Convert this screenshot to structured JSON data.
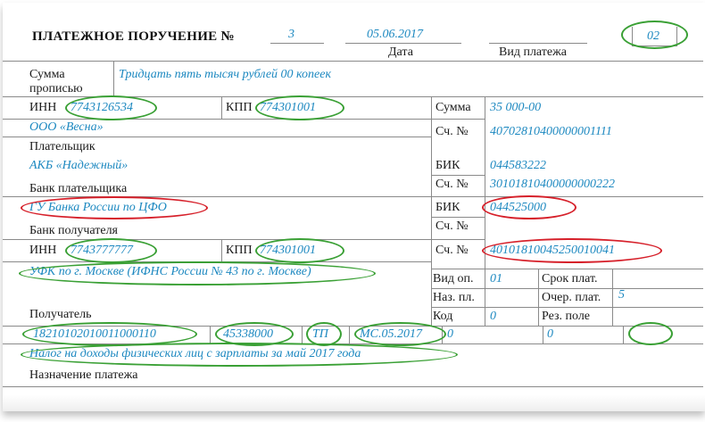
{
  "header": {
    "title": "ПЛАТЕЖНОЕ ПОРУЧЕНИЕ №",
    "number": "3",
    "date": "05.06.2017",
    "date_label": "Дата",
    "payment_type_label": "Вид платежа",
    "status_code": "02"
  },
  "amount_words": {
    "label_line1": "Сумма",
    "label_line2": "прописью",
    "value": "Тридцать пять тысяч рублей 00 копеек"
  },
  "payer": {
    "inn_label": "ИНН",
    "inn": "7743126534",
    "kpp_label": "КПП",
    "kpp": "774301001",
    "name": "ООО «Весна»",
    "label": "Плательщик",
    "amount_label": "Сумма",
    "amount": "35 000-00",
    "account_label": "Сч. №",
    "account": "40702810400000001111"
  },
  "payer_bank": {
    "name": "АКБ «Надежный»",
    "label": "Банк плательщика",
    "bik_label": "БИК",
    "bik": "044583222",
    "account_label": "Сч. №",
    "account": "30101810400000000222"
  },
  "payee_bank": {
    "name": "ГУ Банка России по ЦФО",
    "label": "Банк получателя",
    "bik_label": "БИК",
    "bik": "044525000",
    "account_label": "Сч. №"
  },
  "payee": {
    "inn_label": "ИНН",
    "inn": "7743777777",
    "kpp_label": "КПП",
    "kpp": "774301001",
    "account_label": "Сч. №",
    "account": "40101810045250010041",
    "name": "УФК по г. Москве (ИФНС России № 43 по г. Москве)",
    "label": "Получатель"
  },
  "details": {
    "vid_op_label": "Вид оп.",
    "vid_op": "01",
    "srok_label": "Срок плат.",
    "naz_pl_label": "Наз. пл.",
    "ocher_label": "Очер. плат.",
    "ocher": "5",
    "kod_label": "Код",
    "kod": "0",
    "rez_label": "Рез. поле"
  },
  "tax_fields": {
    "kbk": "18210102010011000110",
    "oktmo": "45338000",
    "basis": "ТП",
    "period": "МС.05.2017",
    "doc_number": "0",
    "doc_date": "0"
  },
  "purpose": {
    "value": "Налог на доходы физических лиц с зарплаты за май 2017 года",
    "label": "Назначение платежа"
  },
  "colors": {
    "value_text": "#1c88c0",
    "green_mark": "#3aa035",
    "red_mark": "#d6202a",
    "rule": "#8a8a8a"
  }
}
